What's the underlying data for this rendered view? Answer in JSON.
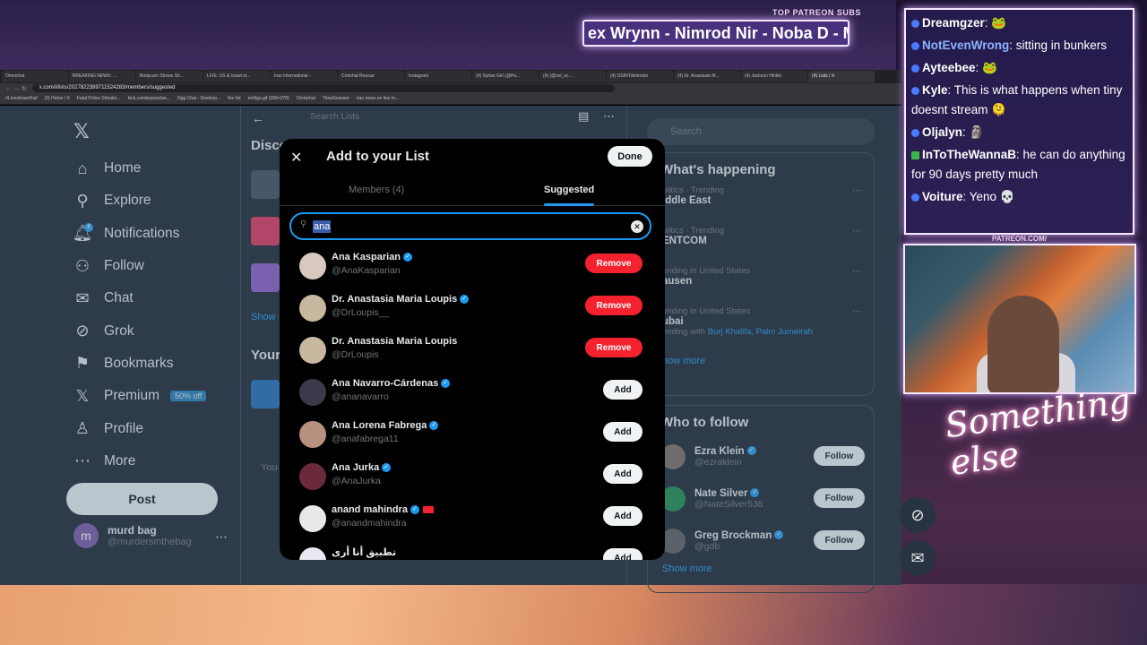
{
  "overlay": {
    "patreon_label": "TOP PATREON SUBS",
    "patreon_ticker": "ex Wrynn - Nimrod Nir - Noba D - Mep",
    "patreon_url": "PATREON.COM/",
    "neon_sign": "Something else"
  },
  "browser": {
    "tabs": [
      "Omnichat",
      "BREAKING NEWS: ...",
      "Bodycam Shows Sh...",
      "LIVE: US & Israel st...",
      "Iran International -",
      "Crotchal Rescue",
      "Instagram",
      "(4) Syrian Girl (@Pa...",
      "(4) (@sol_sc...",
      "(4) OSINTdefender",
      "(4) Dr. Anastasia M...",
      "(4) Jackson Hinkle",
      "(4) Lists / X"
    ],
    "url": "x.com/i/lists/2027822389711524283/members/suggested",
    "bookmarks": [
      "r/LivestreamFail",
      "(3) Home / X",
      "Fatal Police Shootin...",
      "kick.com/popout/an...",
      "Ogg Chat - Desktop...",
      "the list",
      "emfigo.gif (399×278)",
      "Omnichat",
      "TimeGuesser",
      "iran news on live m..."
    ]
  },
  "sidebar": {
    "items": [
      {
        "label": "Home",
        "icon": "home-icon"
      },
      {
        "label": "Explore",
        "icon": "search-icon"
      },
      {
        "label": "Notifications",
        "icon": "bell-icon",
        "badge": "4"
      },
      {
        "label": "Follow",
        "icon": "follow-icon"
      },
      {
        "label": "Chat",
        "icon": "mail-icon"
      },
      {
        "label": "Grok",
        "icon": "grok-icon"
      },
      {
        "label": "Bookmarks",
        "icon": "bookmark-icon"
      },
      {
        "label": "Premium",
        "icon": "x-icon",
        "badge": "50% off"
      },
      {
        "label": "Profile",
        "icon": "person-icon"
      },
      {
        "label": "More",
        "icon": "more-icon"
      }
    ],
    "post_label": "Post",
    "account": {
      "initial": "m",
      "name": "murd bag",
      "handle": "@murdersinthebag"
    }
  },
  "main": {
    "search_placeholder": "Search Lists",
    "discover": "Disco",
    "show": "Show",
    "your": "Your",
    "you": "You"
  },
  "right": {
    "search_placeholder": "Search",
    "happening_title": "What's happening",
    "trends": [
      {
        "meta": "olitics · Trending",
        "name": "iddle East",
        "extra": ""
      },
      {
        "meta": "olitics · Trending",
        "name": "ENTCOM",
        "extra": ""
      },
      {
        "meta": "ending in United States",
        "name": "ausen",
        "extra": ""
      },
      {
        "meta": "ending in United States",
        "name": "ubai",
        "extra": "ending with",
        "extra_links": "Burj Khalifa, Palm Jumeirah"
      }
    ],
    "show_more": "how more",
    "wtf_title": "Who to follow",
    "follow_label": "Follow",
    "who_to_follow": [
      {
        "name": "Ezra Klein",
        "handle": "@ezraklein",
        "avatar_color": "#7a6a60"
      },
      {
        "name": "Nate Silver",
        "handle": "@NateSilver538",
        "avatar_color": "#1a8a4a"
      },
      {
        "name": "Greg Brockman",
        "handle": "@gdb",
        "avatar_color": "#5a5a5a"
      }
    ],
    "show_more_2": "Show more"
  },
  "modal": {
    "title": "Add to your List",
    "done_label": "Done",
    "tabs": [
      "Members (4)",
      "Suggested"
    ],
    "search_value": "ana",
    "remove_label": "Remove",
    "add_label": "Add",
    "results": [
      {
        "name": "Ana Kasparian",
        "handle": "@AnaKasparian",
        "verified": true,
        "action": "Remove",
        "avatar_color": "#d8c8c0"
      },
      {
        "name": "Dr. Anastasia Maria Loupis",
        "handle": "@DrLoupis__",
        "verified": true,
        "action": "Remove",
        "avatar_color": "#c8b8a0"
      },
      {
        "name": "Dr. Anastasia Maria Loupis",
        "handle": "@DrLoupis",
        "verified": false,
        "action": "Remove",
        "avatar_color": "#c8b8a0"
      },
      {
        "name": "Ana Navarro-Cárdenas",
        "handle": "@ananavarro",
        "verified": true,
        "action": "Add",
        "avatar_color": "#3a3a4a"
      },
      {
        "name": "Ana Lorena Fabrega",
        "handle": "@anafabrega11",
        "verified": true,
        "action": "Add",
        "avatar_color": "#b89080"
      },
      {
        "name": "Ana Jurka",
        "handle": "@AnaJurka",
        "verified": true,
        "action": "Add",
        "avatar_color": "#6a2a3a"
      },
      {
        "name": "anand mahindra",
        "handle": "@anandmahindra",
        "verified": true,
        "action": "Add",
        "avatar_color": "#e8e8e8"
      },
      {
        "name": "تطبيق أنا أرى",
        "handle": "",
        "verified": false,
        "action": "Add",
        "avatar_color": "#e8e8f0"
      }
    ]
  },
  "chat": {
    "messages": [
      {
        "user": "Dreamgzer",
        "text": ": 🐸"
      },
      {
        "user": "NotEvenWrong",
        "text": ": sitting in bunkers"
      },
      {
        "user": "Ayteebee",
        "text": ": 🐸"
      },
      {
        "user": "Kyle",
        "text": ": This is what happens when tiny doesnt stream 🫠"
      },
      {
        "user": "Oljalyn",
        "text": ": 🗿"
      },
      {
        "user": "InToTheWannaB",
        "text": ": he can do anything for 90 days pretty much"
      },
      {
        "user": "Voiture",
        "text": ": Yeno 💀"
      }
    ]
  },
  "colors": {
    "accent": "#1d9bf0",
    "danger": "#f4212e",
    "bg": "#15202b"
  }
}
